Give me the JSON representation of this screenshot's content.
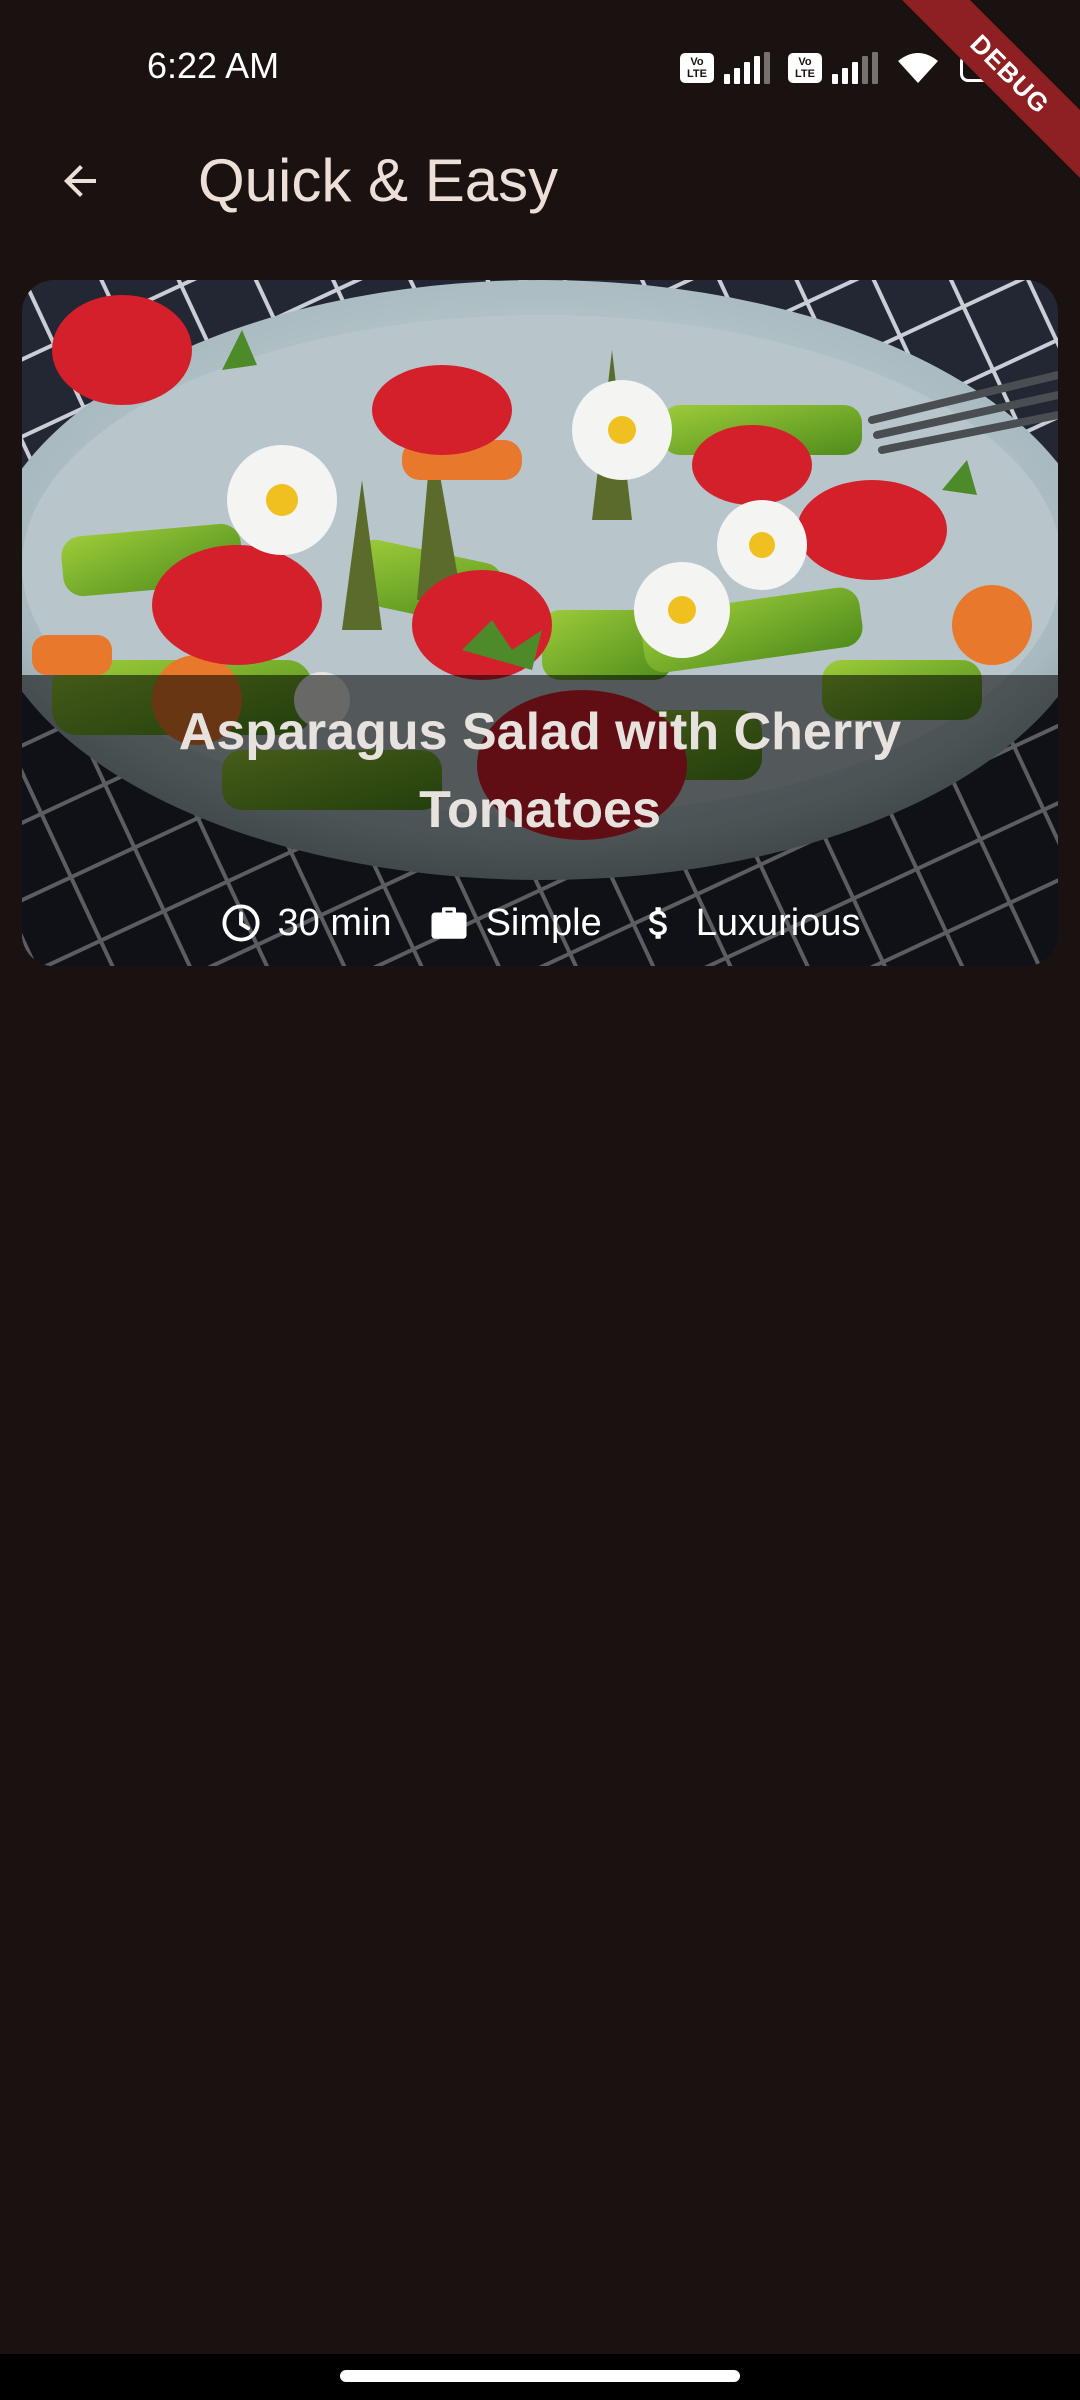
{
  "status_bar": {
    "time": "6:22 AM",
    "volte_label": "Vo\nLTE",
    "battery_level": "71"
  },
  "debug_banner": "DEBUG",
  "app_bar": {
    "title": "Quick & Easy",
    "back_icon": "arrow-back-icon"
  },
  "meals": [
    {
      "title": "Asparagus Salad with Cherry Tomatoes",
      "duration": "30 min",
      "complexity": "Simple",
      "affordability": "Luxurious",
      "icons": {
        "duration": "clock-icon",
        "complexity": "briefcase-icon",
        "affordability": "dollar-icon"
      }
    }
  ],
  "colors": {
    "background": "#1a1210",
    "title_text": "#eddfd8",
    "debug_ribbon": "#8e1f22"
  }
}
